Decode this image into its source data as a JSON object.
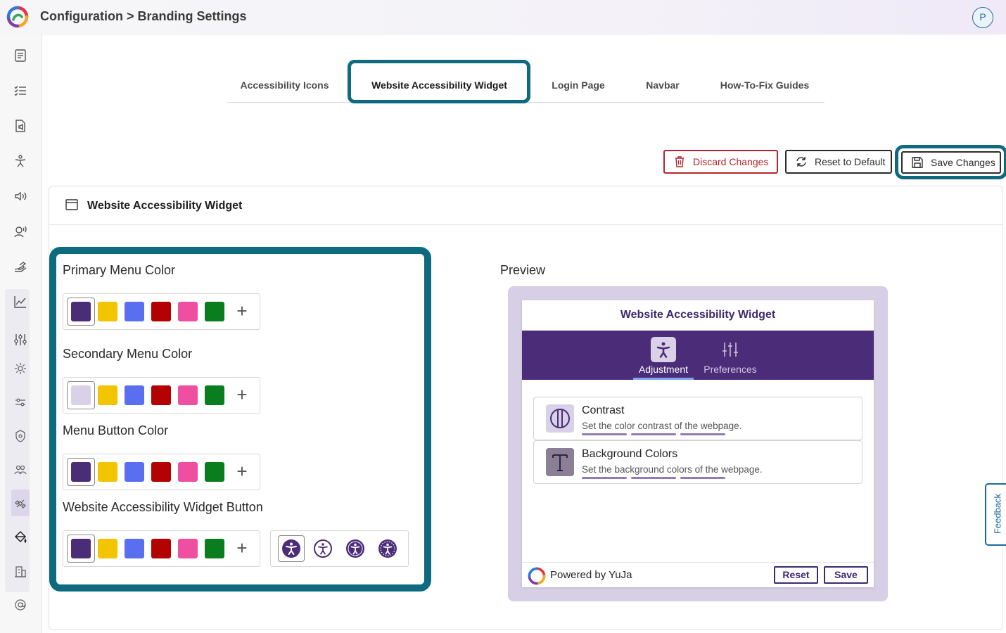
{
  "header": {
    "breadcrumb": "Configuration > Branding Settings",
    "avatar_initial": "P"
  },
  "sidebar": {
    "items": [
      "document-icon",
      "checklist-icon",
      "audio-file-icon",
      "accessibility-star-icon",
      "speaker-icon",
      "voice-user-icon",
      "hand-icon",
      "chart-line-icon",
      "sliders-icon",
      "gear-icon",
      "filter-sliders-icon",
      "shield-icon",
      "users-icon",
      "satellite-icon",
      "paint-bucket-icon",
      "building-icon",
      "at-sign-icon"
    ],
    "active_item": "paint-bucket-icon"
  },
  "tabs": [
    {
      "label": "Accessibility Icons",
      "active": false
    },
    {
      "label": "Website Accessibility Widget",
      "active": true
    },
    {
      "label": "Login Page",
      "active": false
    },
    {
      "label": "Navbar",
      "active": false
    },
    {
      "label": "How-To-Fix Guides",
      "active": false
    }
  ],
  "actions": {
    "discard": "Discard Changes",
    "reset": "Reset to Default",
    "save": "Save Changes"
  },
  "card": {
    "title": "Website Accessibility Widget"
  },
  "settings": {
    "primary": {
      "label": "Primary Menu Color",
      "selected": "#4b2c79"
    },
    "secondary": {
      "label": "Secondary Menu Color",
      "selected": "#d8d1e8"
    },
    "menu_button": {
      "label": "Menu Button Color",
      "selected": "#4b2c79"
    },
    "widget_button": {
      "label": "Website Accessibility Widget Button",
      "selected": "#4b2c79"
    },
    "palette": [
      "#f2c500",
      "#5a6ef0",
      "#b30000",
      "#ef4fa0",
      "#0a7d1e"
    ],
    "button_icons": [
      "accessibility-person-icon",
      "accessibility-circle-icon",
      "accessibility-filled-icon",
      "accessibility-dotted-icon"
    ]
  },
  "preview": {
    "label": "Preview",
    "widget_title": "Website Accessibility Widget",
    "tabs": [
      {
        "label": "Adjustment",
        "active": true
      },
      {
        "label": "Preferences",
        "active": false
      }
    ],
    "options": [
      {
        "title": "Contrast",
        "desc": "Set the color contrast of the webpage."
      },
      {
        "title": "Background Colors",
        "desc": "Set the background colors of the webpage."
      }
    ],
    "powered_by": "Powered by YuJa",
    "reset": "Reset",
    "save": "Save"
  },
  "feedback": "Feedback",
  "colors": {
    "accent_ring": "#0e6a7e",
    "brand_purple": "#4b2c79",
    "discard_red": "#b3262e"
  }
}
